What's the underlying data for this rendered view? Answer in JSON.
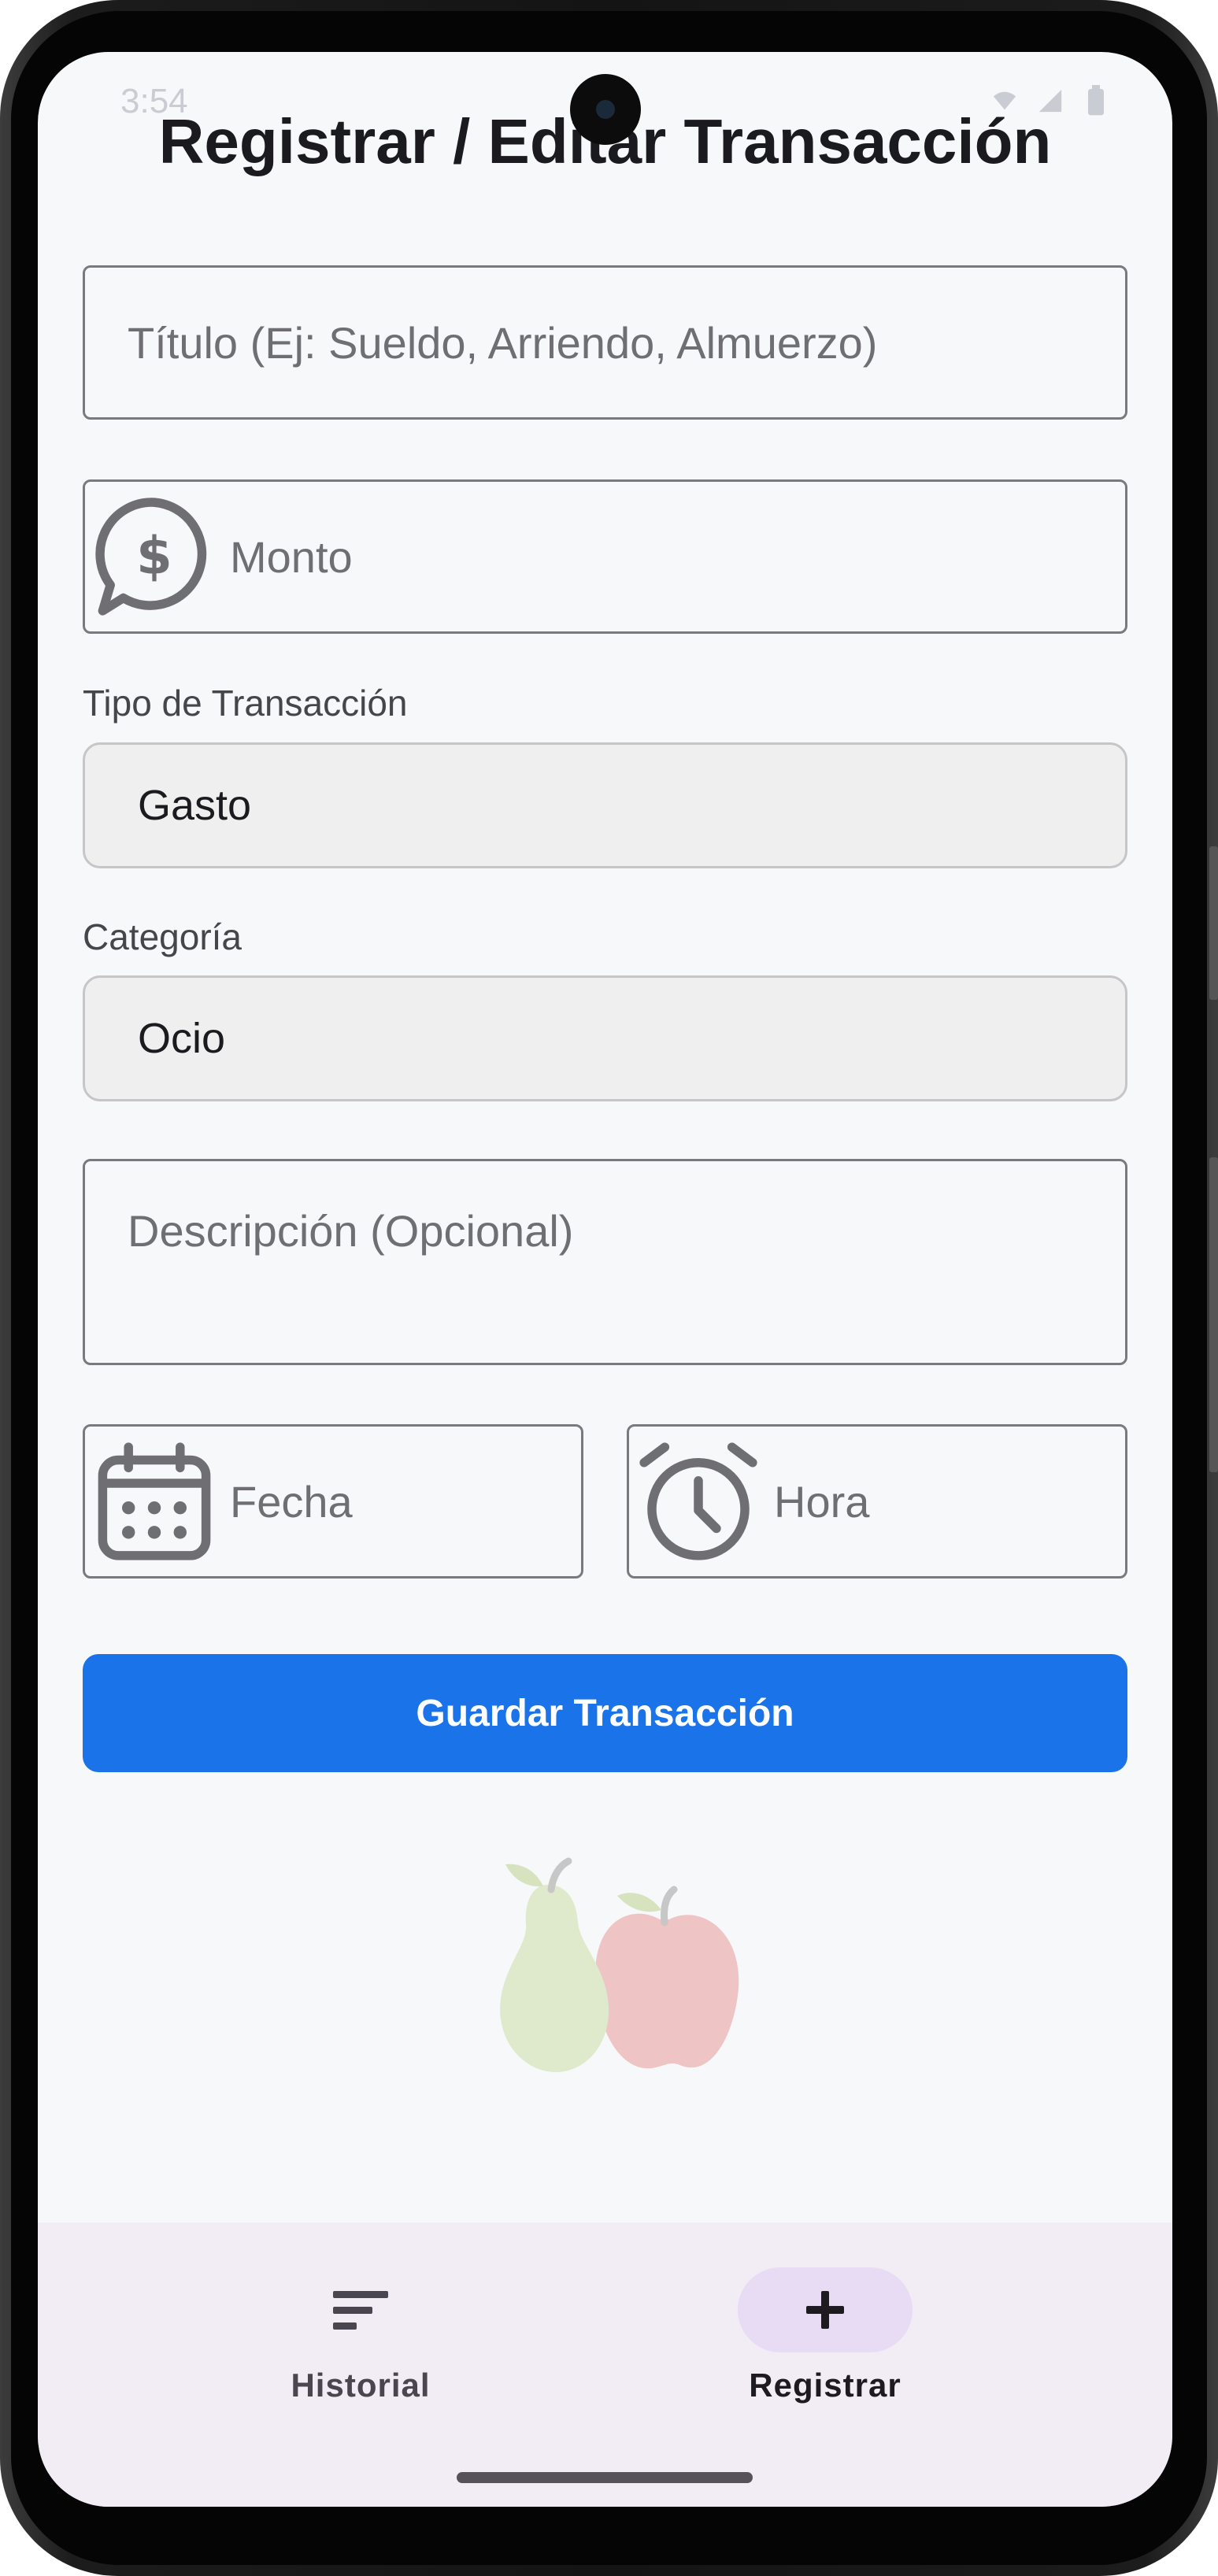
{
  "status_bar": {
    "time": "3:54",
    "icons": [
      "shield-icon",
      "sim-icon",
      "wifi-icon",
      "signal-icon",
      "battery-icon"
    ]
  },
  "page": {
    "title": "Registrar / Editar Transacción"
  },
  "form": {
    "title_field": {
      "value": "",
      "placeholder": "Título (Ej: Sueldo, Arriendo, Almuerzo)"
    },
    "amount_field": {
      "value": "",
      "placeholder": "Monto",
      "icon": "dollar-chat-icon"
    },
    "type_field": {
      "label": "Tipo de Transacción",
      "selected": "Gasto"
    },
    "category_field": {
      "label": "Categoría",
      "selected": "Ocio"
    },
    "description_field": {
      "value": "",
      "placeholder": "Descripción (Opcional)"
    },
    "date_field": {
      "value": "",
      "placeholder": "Fecha",
      "icon": "calendar-icon"
    },
    "time_field": {
      "value": "",
      "placeholder": "Hora",
      "icon": "alarm-clock-icon"
    },
    "save_button": "Guardar Transacción"
  },
  "illustration": {
    "icons": [
      "pear-icon",
      "apple-icon"
    ]
  },
  "bottom_nav": {
    "items": [
      {
        "label": "Historial",
        "icon": "sort-lines-icon",
        "active": false
      },
      {
        "label": "Registrar",
        "icon": "plus-icon",
        "active": true
      }
    ]
  },
  "colors": {
    "primary": "#1a73e8",
    "background": "#f7f8fa",
    "nav_background": "#f2ecf5",
    "nav_active_pill": "#e7dcf3"
  }
}
